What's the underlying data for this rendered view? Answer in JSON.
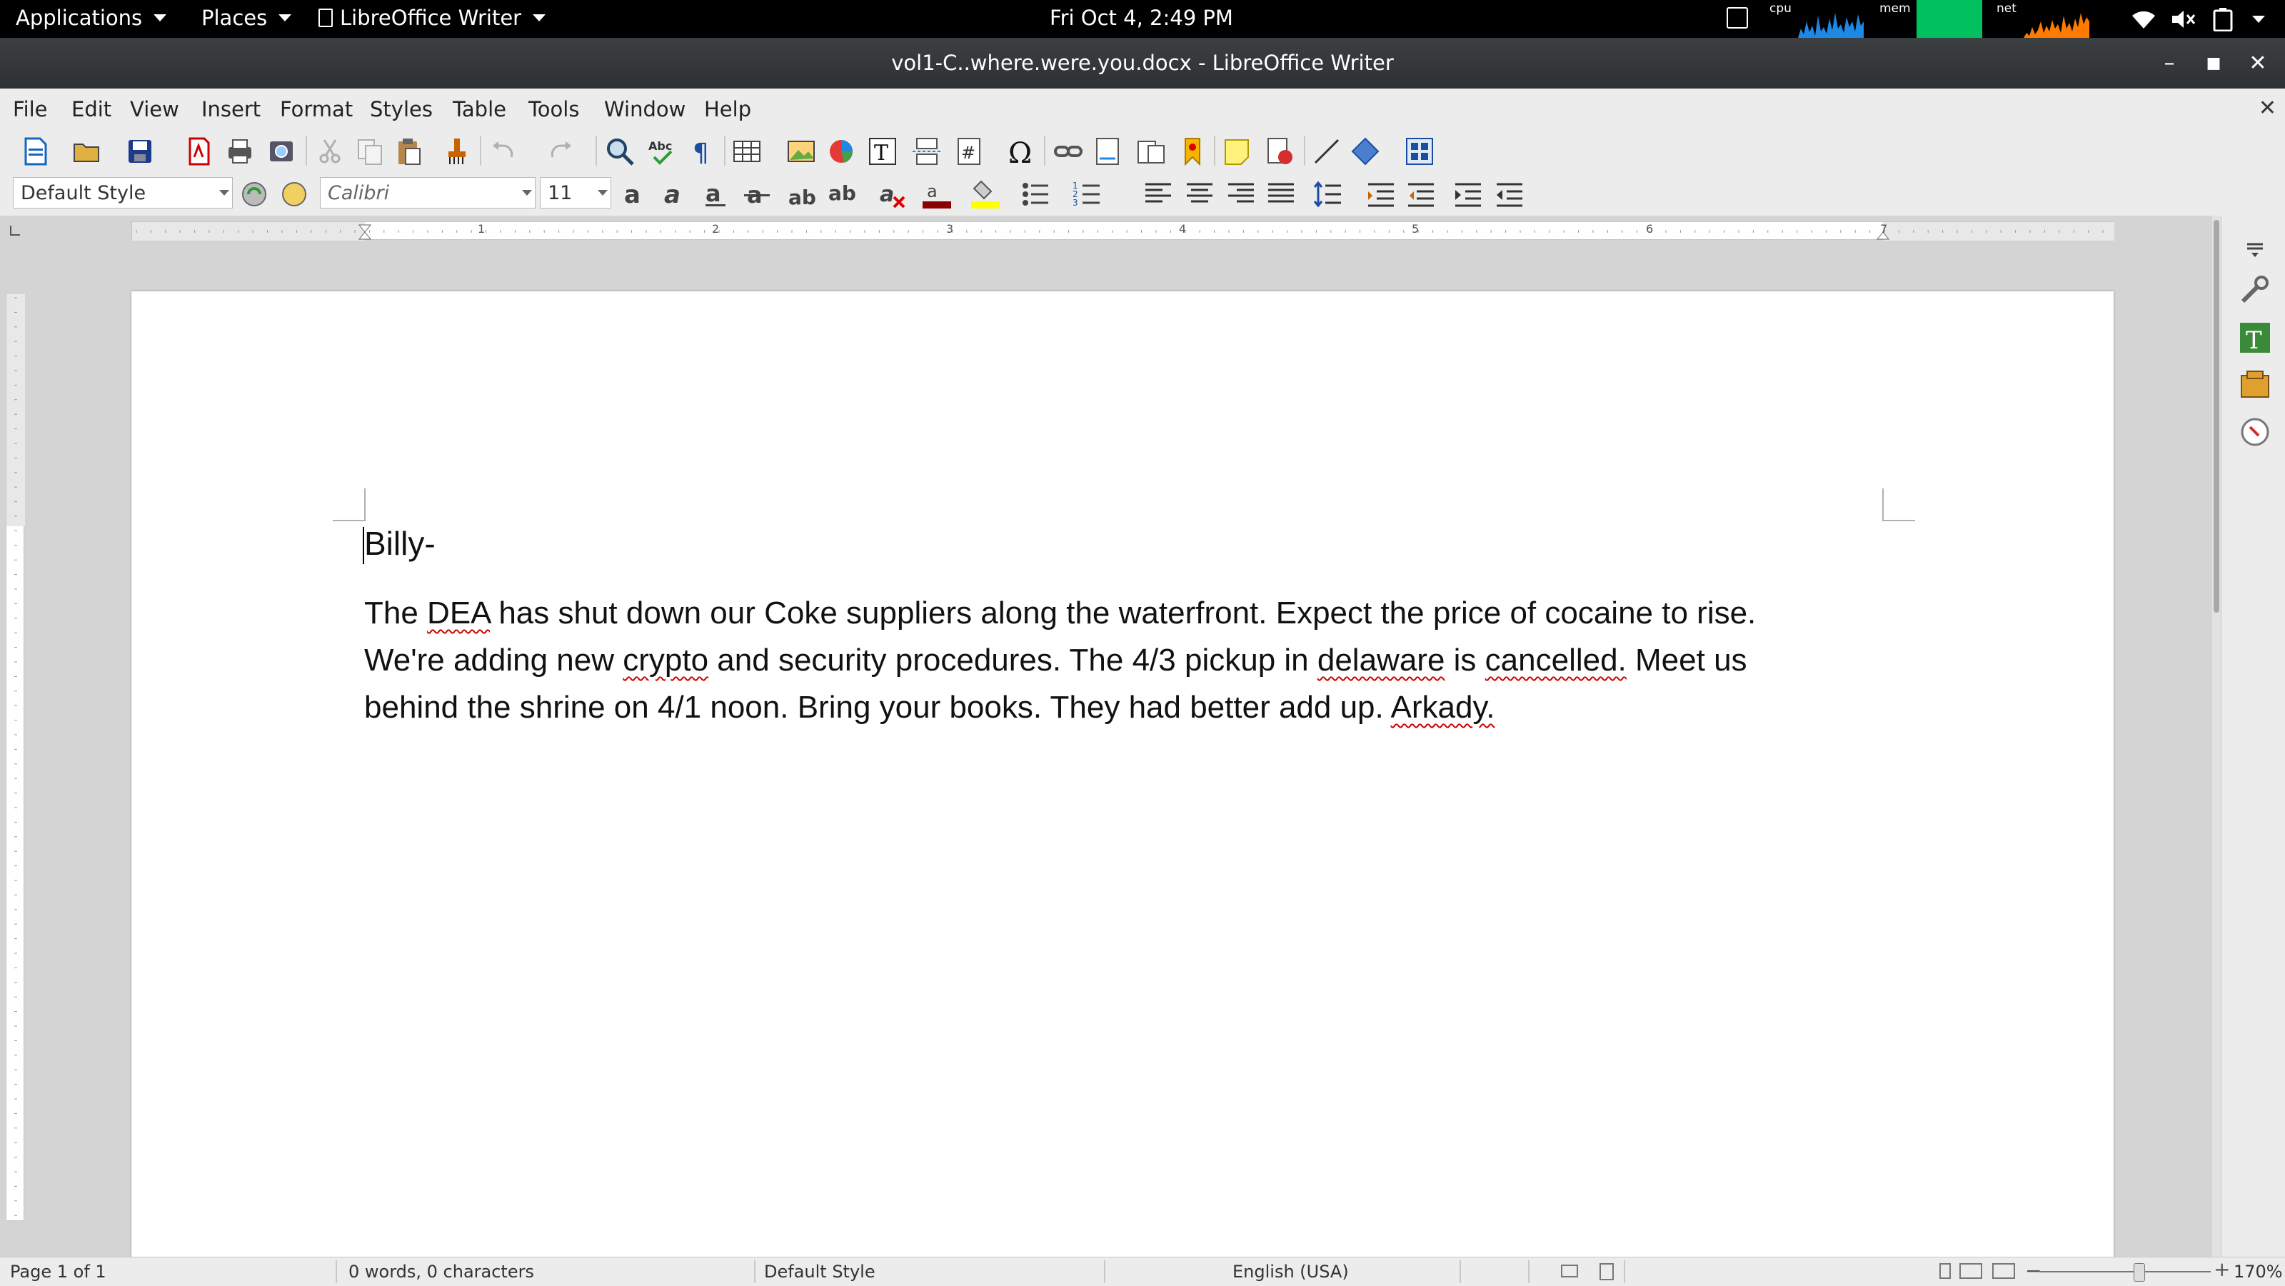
{
  "topbar": {
    "applications": "Applications",
    "places": "Places",
    "app_name": "LibreOffice Writer",
    "clock": "Fri Oct  4,  2:49 PM",
    "cpu_label": "cpu",
    "mem_label": "mem",
    "net_label": "net"
  },
  "window": {
    "title": "vol1-C..where.were.you.docx - LibreOffice Writer"
  },
  "menubar": {
    "items": [
      "File",
      "Edit",
      "View",
      "Insert",
      "Format",
      "Styles",
      "Table",
      "Tools",
      "Window",
      "Help"
    ]
  },
  "formatting": {
    "paragraph_style": "Default Style",
    "font_name": "Calibri",
    "font_size": "11"
  },
  "ruler": {
    "labels": [
      "1",
      "2",
      "3",
      "4",
      "5",
      "6",
      "7"
    ]
  },
  "document": {
    "heading": "Billy-",
    "body_parts": [
      "The ",
      "DEA",
      " has shut down our Coke suppliers along the waterfront. Expect the price of cocaine to rise. We're adding new ",
      "crypto",
      " and security procedures. The 4/3 pickup in ",
      "delaware",
      " is ",
      "cancelled.",
      " Meet us behind the shrine on 4/1 noon. Bring your books. They had better add up. ",
      "Arkady."
    ]
  },
  "statusbar": {
    "page": "Page 1 of 1",
    "words": "0 words, 0 characters",
    "style": "Default Style",
    "language": "English (USA)",
    "zoom": "170%"
  },
  "colors": {
    "font_color": "#8b0000",
    "highlight_color": "#ffff00",
    "spell_underline": "#d00000",
    "mem_graph": "#00c060",
    "cpu_graph": "#1e88e5",
    "net_graph": "#ff7a00"
  }
}
